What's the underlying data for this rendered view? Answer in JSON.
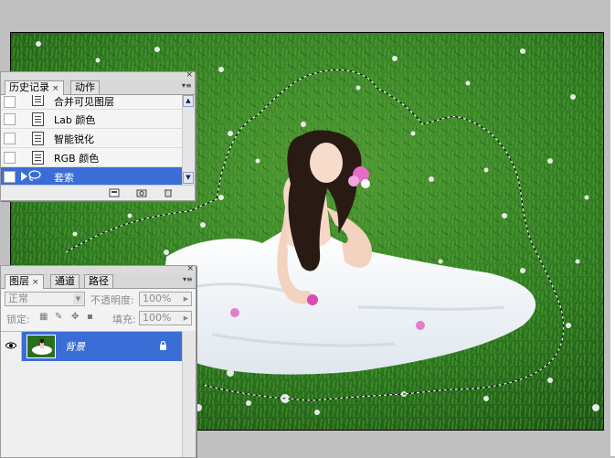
{
  "colors": {
    "workspace": "#c0c0c0",
    "selection": "#3a6ed6",
    "grass": "#2d6e1e"
  },
  "history_panel": {
    "tabs": [
      {
        "label": "历史记录",
        "active": true,
        "close": "×"
      },
      {
        "label": "动作",
        "active": false
      }
    ],
    "items": [
      {
        "label": "合并可见图层",
        "icon": "document-icon",
        "selected": false
      },
      {
        "label": "Lab 颜色",
        "icon": "document-icon",
        "selected": false
      },
      {
        "label": "智能锐化",
        "icon": "document-icon",
        "selected": false
      },
      {
        "label": "RGB 颜色",
        "icon": "document-icon",
        "selected": false
      },
      {
        "label": "套索",
        "icon": "lasso-icon",
        "selected": true
      }
    ],
    "footer_icons": [
      "new-document-from-state-icon",
      "snapshot-camera-icon",
      "trash-icon"
    ]
  },
  "layers_panel": {
    "tabs": [
      {
        "label": "图层",
        "active": true,
        "close": "×"
      },
      {
        "label": "通道",
        "active": false
      },
      {
        "label": "路径",
        "active": false
      }
    ],
    "blend_mode": "正常",
    "opacity_label": "不透明度:",
    "opacity_value": "100%",
    "lock_label": "锁定:",
    "fill_label": "填充:",
    "fill_value": "100%",
    "layers": [
      {
        "name": "背景",
        "visible": true,
        "locked": true,
        "selected": true
      }
    ]
  }
}
